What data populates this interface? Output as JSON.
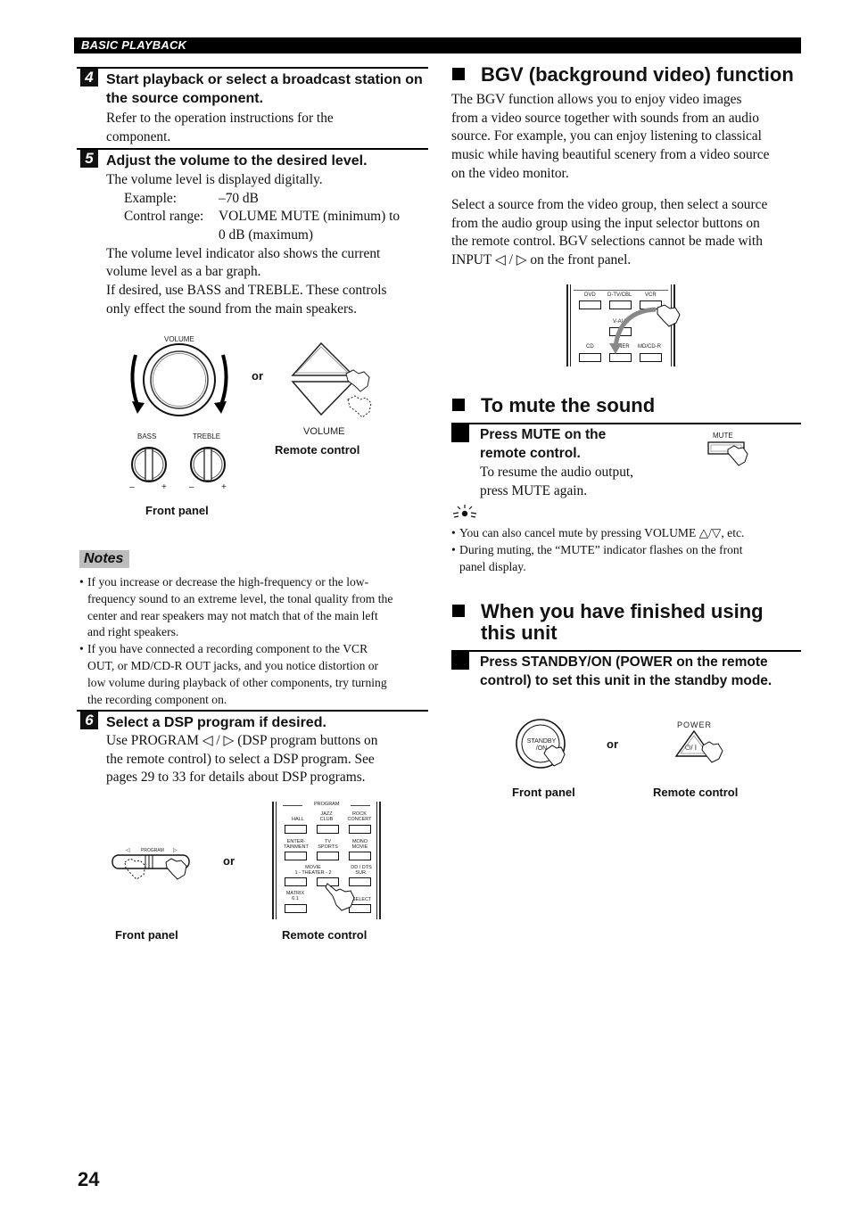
{
  "header": {
    "section": "BASIC PLAYBACK"
  },
  "steps": [
    {
      "number": "4",
      "heading": "Start playback or select a broadcast station on the source component.",
      "body": [
        "Refer to the operation instructions for the",
        "component."
      ]
    },
    {
      "number": "5",
      "heading": "Adjust the volume to the desired level.",
      "intro": "The volume level is displayed digitally.",
      "example_label": "Example:",
      "example_value": "–70 dB",
      "range_label": "Control range:",
      "range_value_1": "VOLUME MUTE (minimum) to",
      "range_value_2": "0 dB (maximum)",
      "body": [
        "The volume level indicator also shows the current",
        "volume level as a bar graph.",
        "If desired, use BASS and TREBLE. These controls",
        "only effect the sound from the main speakers."
      ]
    },
    {
      "number": "6",
      "heading": "Select a DSP program if desired.",
      "body": [
        "Use PROGRAM ◁ / ▷ (DSP program buttons on",
        "the remote control) to select a DSP program. See",
        "pages 29 to 33 for details about DSP programs."
      ]
    }
  ],
  "volume_figure": {
    "knob_label": "VOLUME",
    "or": "or",
    "remote_volume_label": "VOLUME",
    "bass_label": "BASS",
    "treble_label": "TREBLE",
    "minus": "–",
    "plus": "+",
    "front_caption": "Front panel",
    "remote_caption": "Remote control"
  },
  "notes": {
    "title": "Notes",
    "items": [
      [
        "If you increase or decrease the high-frequency or the low-",
        "frequency sound to an extreme level, the tonal quality from the",
        "center and rear speakers may not match that of the main left",
        "and right speakers."
      ],
      [
        "If you have connected a recording component to the VCR",
        "OUT, or MD/CD-R OUT jacks, and you notice distortion or",
        "low volume during playback of other components, try turning",
        "the recording component on."
      ]
    ]
  },
  "program_figure": {
    "front_left": "◁",
    "front_label": "PROGRAM",
    "front_right": "▷",
    "or": "or",
    "remote_title": "PROGRAM",
    "buttons": [
      [
        "HALL",
        "JAZZ CLUB",
        "ROCK CONCERT"
      ],
      [
        "ENTER-TAINMENT",
        "TV SPORTS",
        "MONO MOVIE"
      ],
      [
        "MOVIE 1 - THEATER - 2",
        "",
        "DD / DTS SUR."
      ],
      [
        "MATRIX 6.1",
        "",
        "SELECT"
      ]
    ],
    "labels": {
      "hall": "HALL",
      "jazz1": "JAZZ",
      "jazz2": "CLUB",
      "rock1": "ROCK",
      "rock2": "CONCERT",
      "ent1": "ENTER-",
      "ent2": "TAINMENT",
      "tv1": "TV",
      "tv2": "SPORTS",
      "mono1": "MONO",
      "mono2": "MOVIE",
      "movie1": "MOVIE",
      "movie2": "1 - THEATER - 2",
      "dd1": "DD / DTS",
      "dd2": "SUR.",
      "matrix1": "MATRIX",
      "matrix2": "6.1",
      "select": "SELECT"
    },
    "front_caption": "Front panel",
    "remote_caption": "Remote control"
  },
  "bgv": {
    "title": "BGV (background video) function",
    "para1": [
      "The BGV function allows you to enjoy video images",
      "from a video source together with sounds from an audio",
      "source. For example, you can enjoy listening to classical",
      "music while having beautiful scenery from a video source",
      "on the video monitor."
    ],
    "para2": [
      "Select a source from the video group, then select a source",
      "from the audio group using the input selector buttons on",
      "the remote control. BGV selections cannot be made with",
      "INPUT ◁ / ▷ on the front panel."
    ],
    "remote_buttons": {
      "dvd": "DVD",
      "dtv": "D-TV/CBL",
      "vcr": "VCR",
      "vaux": "V-AUX",
      "cd": "CD",
      "tuner": "TUNER",
      "mdcdr": "MD/CD-R"
    }
  },
  "mute": {
    "title": "To mute the sound",
    "step_heading_1": "Press MUTE on the",
    "step_heading_2": "remote control.",
    "body": [
      "To resume the audio output,",
      "press MUTE again."
    ],
    "button_label": "MUTE",
    "tip_icon": "lightbulb-tip-icon",
    "tips": [
      [
        "You can also cancel mute by pressing VOLUME △/▽, etc."
      ],
      [
        "During muting, the “MUTE” indicator flashes on the front",
        "panel display."
      ]
    ]
  },
  "finish": {
    "title_1": "When you have finished using",
    "title_2": "this unit",
    "step_heading_1": "Press STANDBY/ON (POWER on the remote",
    "step_heading_2": "control) to set this unit in the standby mode.",
    "standby_label_1": "STANDBY",
    "standby_label_2": "/ON",
    "or": "or",
    "power_label": "POWER",
    "power_symbol": "⏻/ I",
    "front_caption": "Front panel",
    "remote_caption": "Remote control"
  },
  "page_number": "24"
}
